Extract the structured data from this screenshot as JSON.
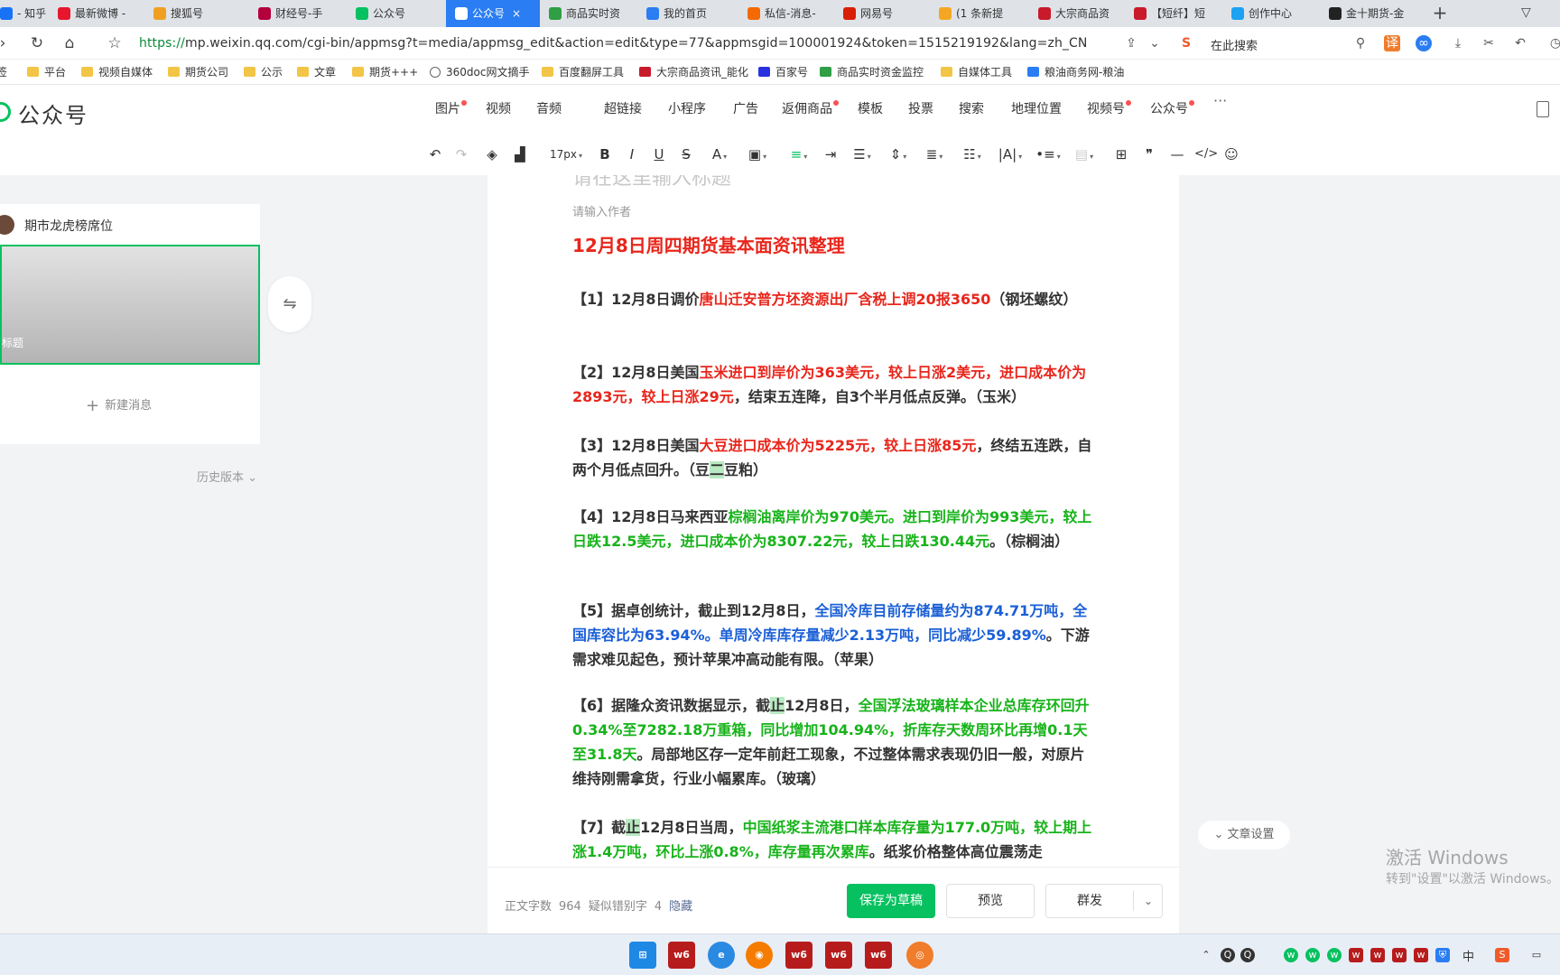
{
  "browser": {
    "tabs": [
      {
        "label": "- 知乎",
        "color": "#1772f6",
        "active": false
      },
      {
        "label": "最新微博 -",
        "color": "#e6162d",
        "active": false
      },
      {
        "label": "搜狐号",
        "color": "#f0a020",
        "active": false
      },
      {
        "label": "财经号-手",
        "color": "#b4003c",
        "active": false
      },
      {
        "label": "公众号",
        "color": "#07c160",
        "active": false
      },
      {
        "label": "公众号",
        "color": "#ffffff",
        "active": true
      },
      {
        "label": "商品实时资",
        "color": "#2f9e44",
        "active": false
      },
      {
        "label": "我的首页",
        "color": "#2a7df2",
        "active": false
      },
      {
        "label": "私信-消息-",
        "color": "#f56a00",
        "active": false
      },
      {
        "label": "网易号",
        "color": "#d81e06",
        "active": false
      },
      {
        "label": "(1 条新提",
        "color": "#f5a623",
        "active": false
      },
      {
        "label": "大宗商品资",
        "color": "#c81a2a",
        "active": false
      },
      {
        "label": "【短纤】短",
        "color": "#c81a2a",
        "active": false
      },
      {
        "label": "创作中心",
        "color": "#1da1f2",
        "active": false
      },
      {
        "label": "金十期货-金",
        "color": "#222222",
        "active": false
      }
    ],
    "url_proto": "https://",
    "url_host": "mp.weixin.qq.com",
    "url_path": "/cgi-bin/appmsg?t=media/appmsg_edit&action=edit&type=77&appmsgid=100001924&token=1515219192&lang=zh_CN",
    "search_label": "在此搜索",
    "bookmarks": [
      "签",
      "平台",
      "视频自媒体",
      "期货公司",
      "公示",
      "文章",
      "期货+++",
      "360doc网文摘手",
      "百度翻屏工具",
      "大宗商品资讯_能化",
      "百家号",
      "商品实时资金监控",
      "自媒体工具",
      "粮油商务网-粮油"
    ]
  },
  "app": {
    "logo": "公众号",
    "insert_menu": [
      "图片",
      "视频",
      "音频",
      "超链接",
      "小程序",
      "广告",
      "返佣商品",
      "模板",
      "投票",
      "搜索",
      "地理位置",
      "视频号",
      "公众号"
    ],
    "more": "···",
    "font_size": "17px"
  },
  "sidebar": {
    "account_name": "期市龙虎榜席位",
    "thumb_title": "标题",
    "new_message": "新建消息",
    "history": "历史版本"
  },
  "editor": {
    "title_placeholder": "请在这里输入标题",
    "author_placeholder": "请输入作者",
    "headline": "12月8日周四期货基本面资讯整理",
    "p1": {
      "a": "【1】12月8日调价",
      "b": "唐山迁安普方坯资源出厂含税上调20报3650",
      "c": "（钢坯螺纹）"
    },
    "p2": {
      "a": "【2】12月8日美国",
      "b": "玉米进口到岸价为363美元，较上日涨2美元，进口成本价为2893元，较上日涨29元",
      "c": "，结束五连降，自3个半月低点反弹。（玉米）"
    },
    "p3": {
      "a": "【3】12月8日美国",
      "b": "大豆进口成本价为5225元，较上日涨85元",
      "c": "，终结五连跌，自两个月低点回升。（豆",
      "d": "二",
      "e": "豆粕）"
    },
    "p4": {
      "a": "【4】12月8日马来西亚",
      "b": "棕榈油离岸价为970美元。进口到岸价为993美元，较上日跌12.5美元，进口成本价为8307.22元，较上日跌130.44元",
      "c": "。（棕榈油）"
    },
    "p5": {
      "a": "【5】据卓创统计，截止到12月8日，",
      "b": "全国冷库目前存储量约为874.71万吨，全国库容比为63.94%。单周冷库库存量减少2.13万吨，同比减少59.89%",
      "c": "。下游需求难见起色，预计苹果冲高动能有限。（苹果）"
    },
    "p6": {
      "a": "【6】据隆众资讯数据显示，截",
      "hl": "止",
      "a2": "12月8日，",
      "b": "全国浮法玻璃样本企业总库存环回升0.34%至7282.18万重箱，同比增加104.94%，折库存天数周环比再增0.1天至31.8天",
      "c": "。局部地区存一定年前赶工现象，不过整体需求表现仍旧一般，对原片维持刚需拿货，行业小幅累库。（玻璃）"
    },
    "p7": {
      "a": "【7】截",
      "hl": "止",
      "a2": "12月8日当周，",
      "b": "中国纸浆主流港口样本库存量为177.0万吨，较上期上涨1.4万吨，环比上涨0.8%，库存量再次累库",
      "c": "。纸浆价格整体高位震荡走"
    }
  },
  "footer": {
    "word_count_label": "正文字数",
    "word_count": "964",
    "typo_label": "疑似错别字",
    "typo_count": "4",
    "hide": "隐藏",
    "save": "保存为草稿",
    "preview": "预览",
    "send": "群发"
  },
  "article_settings": "文章设置",
  "watermark": {
    "line1": "激活 Windows",
    "line2": "转到\"设置\"以激活 Windows。"
  },
  "taskbar": {
    "ime": "中"
  }
}
